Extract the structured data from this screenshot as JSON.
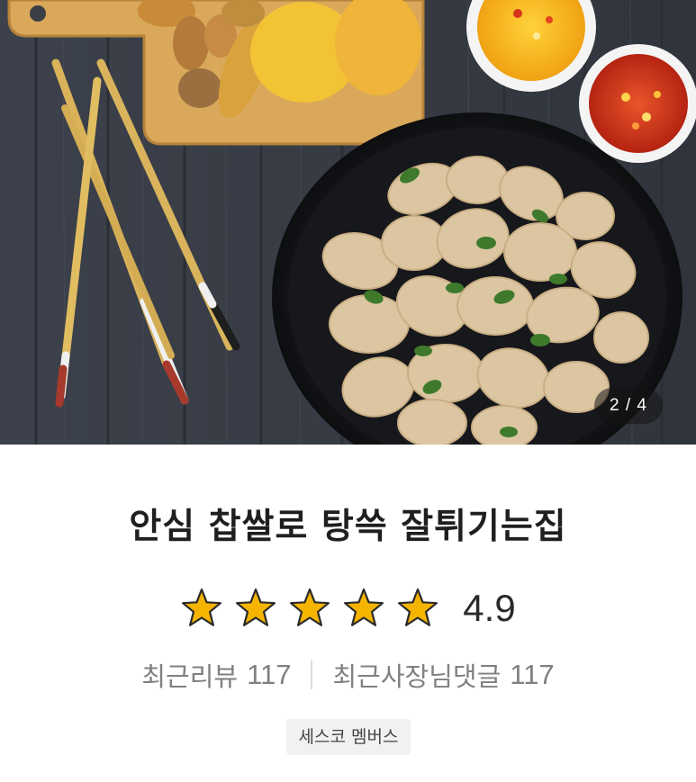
{
  "gallery": {
    "image_alt": "Crispy fried pork tangsuyuk on a black plate with dipping sauces, chopsticks and fried vegetables on a wooden board",
    "counter": "2 / 4"
  },
  "store": {
    "name": "안심 찹쌀로 탕쓱 잘튀기는집",
    "rating": "4.9",
    "rating_value": 4.9,
    "stars_filled": 5,
    "stars_total": 5,
    "star_color": "#f5b400"
  },
  "stats": {
    "recent_reviews_label": "최근리뷰",
    "recent_reviews_count": "117",
    "owner_replies_label": "최근사장님댓글",
    "owner_replies_count": "117"
  },
  "badge": {
    "label": "세스코 멤버스"
  }
}
